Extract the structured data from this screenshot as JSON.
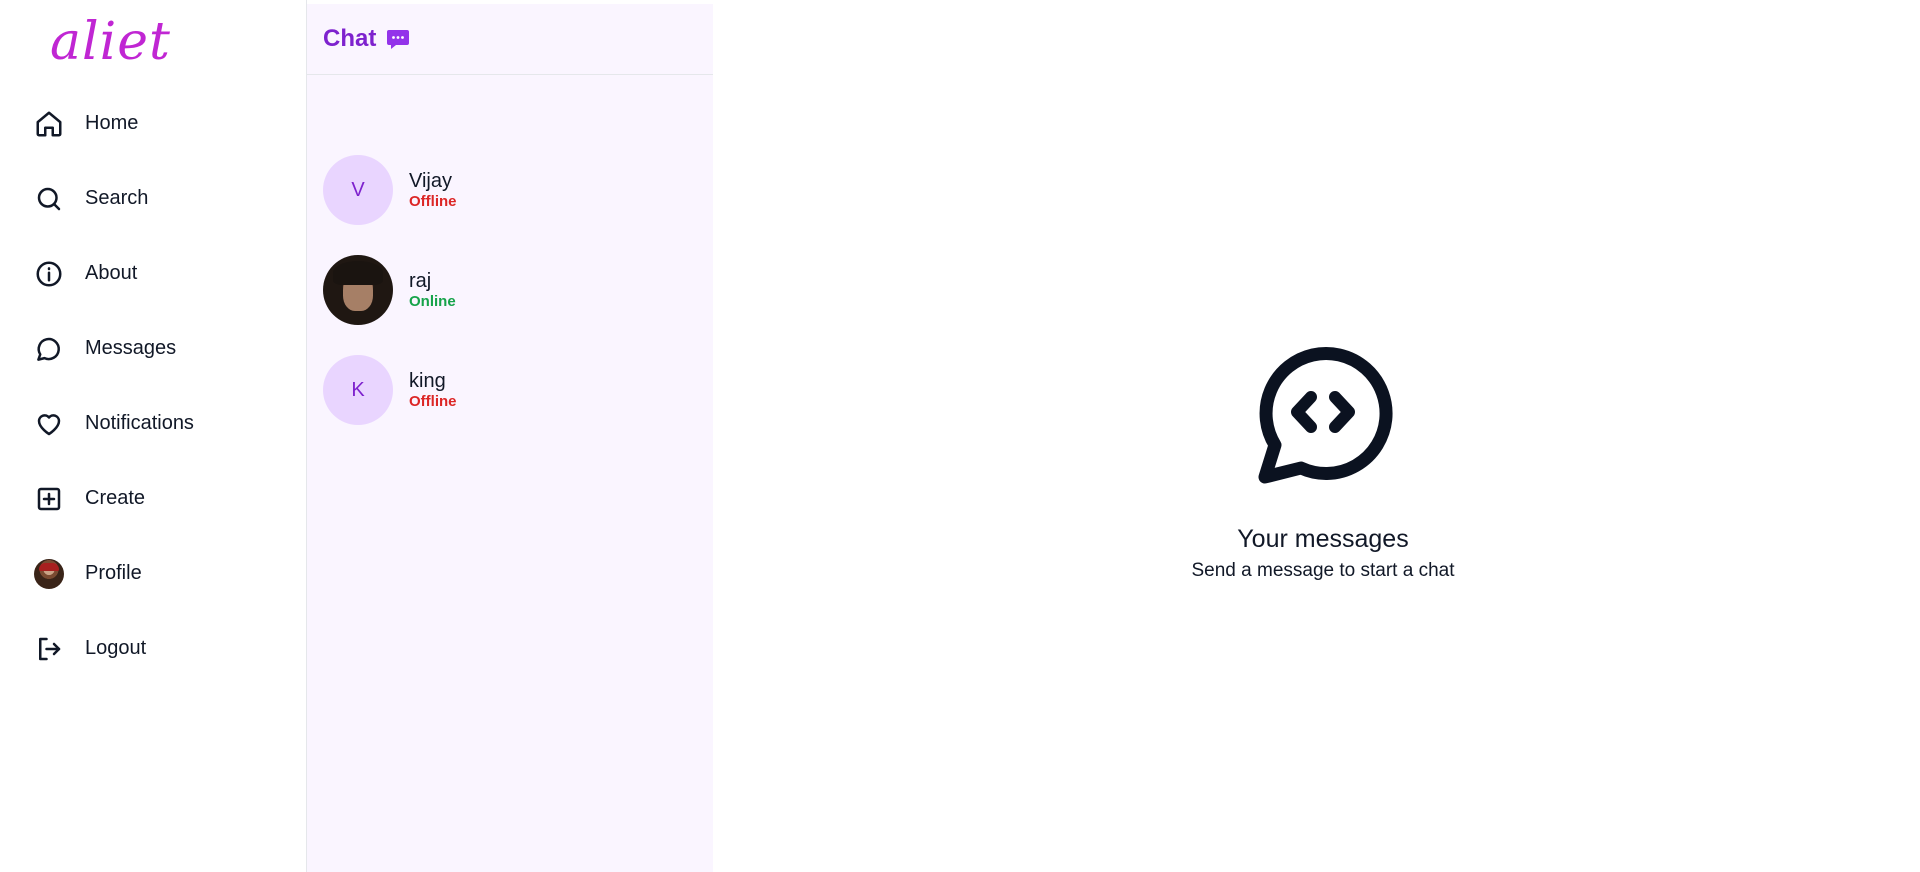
{
  "app": {
    "logo_text": "aliet"
  },
  "sidebar": {
    "items": [
      {
        "label": "Home",
        "icon": "home-icon"
      },
      {
        "label": "Search",
        "icon": "search-icon"
      },
      {
        "label": "About",
        "icon": "info-icon"
      },
      {
        "label": "Messages",
        "icon": "message-circle-icon"
      },
      {
        "label": "Notifications",
        "icon": "heart-icon"
      },
      {
        "label": "Create",
        "icon": "plus-square-icon"
      },
      {
        "label": "Profile",
        "icon": "avatar"
      },
      {
        "label": "Logout",
        "icon": "logout-icon"
      }
    ]
  },
  "chat": {
    "title": "Chat",
    "title_icon": "message-dots-icon",
    "conversations": [
      {
        "name": "Vijay",
        "initial": "V",
        "status": "Offline",
        "has_photo": false
      },
      {
        "name": "raj",
        "initial": "",
        "status": "Online",
        "has_photo": true
      },
      {
        "name": "king",
        "initial": "K",
        "status": "Offline",
        "has_photo": false
      }
    ]
  },
  "empty_state": {
    "icon": "message-code-icon",
    "title": "Your messages",
    "subtitle": "Send a message to start a chat"
  },
  "colors": {
    "brand": "#c026d3",
    "accent": "#7e22ce",
    "panel_bg": "#faf5ff",
    "avatar_bg": "#e9d5ff",
    "offline": "#dc2626",
    "online": "#16a34a"
  }
}
